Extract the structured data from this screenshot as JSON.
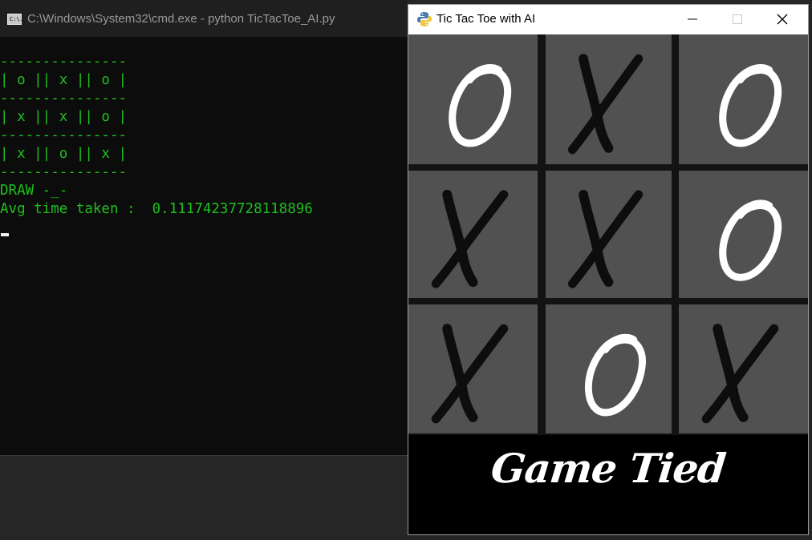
{
  "cmd": {
    "icon_text": "C:\\.",
    "title": "C:\\Windows\\System32\\cmd.exe - python  TicTacToe_AI.py",
    "output_lines": [
      "---------------",
      "| o || x || o |",
      "---------------",
      "| x || x || o |",
      "---------------",
      "| x || o || x |",
      "---------------",
      "DRAW -_-",
      "Avg time taken :  0.11174237728118896"
    ],
    "text_color": "#1fbf1f"
  },
  "game": {
    "title": "Tic Tac Toe with AI",
    "app_icon": "python-icon",
    "window_buttons": [
      "minimize-icon",
      "maximize-icon",
      "close-icon"
    ],
    "board": [
      [
        "o",
        "x",
        "o"
      ],
      [
        "x",
        "x",
        "o"
      ],
      [
        "x",
        "o",
        "x"
      ]
    ],
    "cell_color": "#515151",
    "grid_line_color": "#131313",
    "status": "Game Tied"
  }
}
